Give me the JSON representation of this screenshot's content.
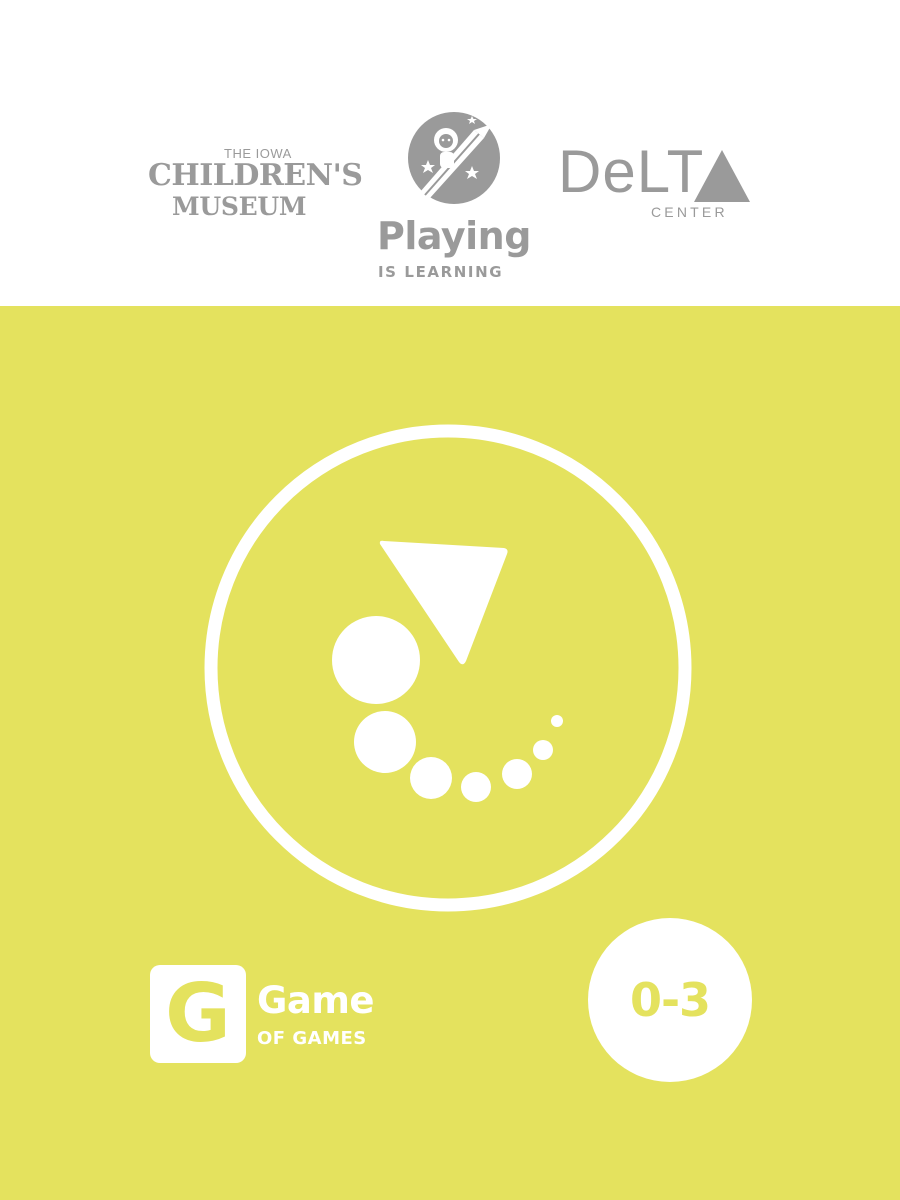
{
  "header": {
    "logos": [
      {
        "name": "iowa-childrens-museum",
        "pre": "THE IOWA",
        "main": "CHILDREN'S",
        "sub": "MUSEUM"
      },
      {
        "name": "playing-is-learning",
        "main": "Playing",
        "sub": "IS LEARNING"
      },
      {
        "name": "delta-center",
        "main": "DeLT",
        "sub": "CENTER"
      }
    ]
  },
  "brand": {
    "logo_letter": "G",
    "title": "Game",
    "subtitle": "OF GAMES"
  },
  "age_badge": "0-3",
  "colors": {
    "panel": "#e4e25e",
    "logo_gray": "#9a9a9a",
    "white": "#ffffff"
  },
  "icons": {
    "hero": "triangle-and-dots-icon",
    "brand": "g-box-icon"
  }
}
